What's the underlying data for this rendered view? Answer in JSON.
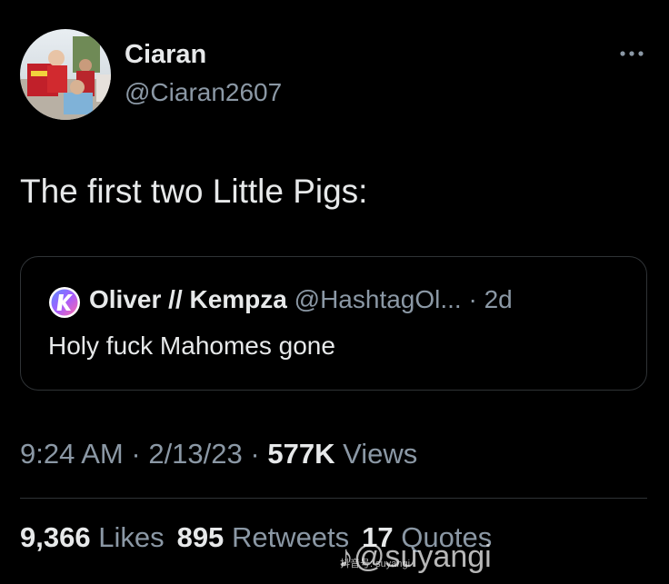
{
  "author": {
    "display_name": "Ciaran",
    "handle": "@Ciaran2607",
    "avatar_icon": "profile-photo"
  },
  "more_icon": "ellipsis-icon",
  "tweet": {
    "text": "The first two Little Pigs:"
  },
  "quote": {
    "author_name": "Oliver // Kempza",
    "author_handle": "@HashtagOl...",
    "separator": "·",
    "age": "2d",
    "text": "Holy fuck Mahomes gone",
    "avatar_icon": "k-logo-icon"
  },
  "meta": {
    "time": "9:24 AM",
    "sep1": "·",
    "date": "2/13/23",
    "sep2": "·",
    "views_count": "577K",
    "views_label": "Views"
  },
  "stats": {
    "likes_count": "9,366",
    "likes_label": "Likes",
    "retweets_count": "895",
    "retweets_label": "Retweets",
    "quotes_count": "17",
    "quotes_label": "Quotes"
  },
  "watermark": {
    "text": "@suyangi",
    "sub": "抖音号: suyangi"
  },
  "colors": {
    "background": "#000000",
    "primary_text": "#e7e9ea",
    "secondary_text": "#8b98a5",
    "border": "#2f3336"
  }
}
